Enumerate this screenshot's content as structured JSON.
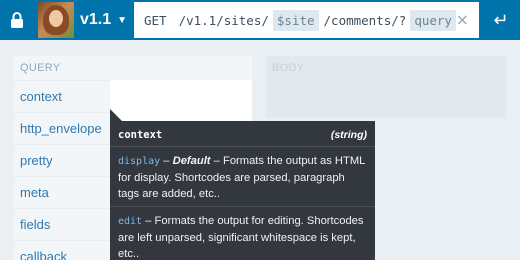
{
  "topbar": {
    "version": "v1.1",
    "method": "GET",
    "path_prefix": "/v1.1/sites/",
    "site_param": "$site",
    "path_suffix": "/comments/?",
    "query_param": "query",
    "clear_symbol": "×",
    "go_symbol": "↵",
    "accent": "#0073aa"
  },
  "query": {
    "title": "QUERY",
    "params": [
      "context",
      "http_envelope",
      "pretty",
      "meta",
      "fields",
      "callback"
    ]
  },
  "body": {
    "title": "BODY"
  },
  "tooltip": {
    "name": "context",
    "type": "(string)",
    "options": [
      {
        "code": "display",
        "default_label": "Default",
        "dash": " – ",
        "description": "Formats the output as HTML for display. Shortcodes are parsed, paragraph tags are added, etc.."
      },
      {
        "code": "edit",
        "description": "Formats the output for editing. Shortcodes are left unparsed, significant whitespace is kept, etc.."
      }
    ]
  }
}
